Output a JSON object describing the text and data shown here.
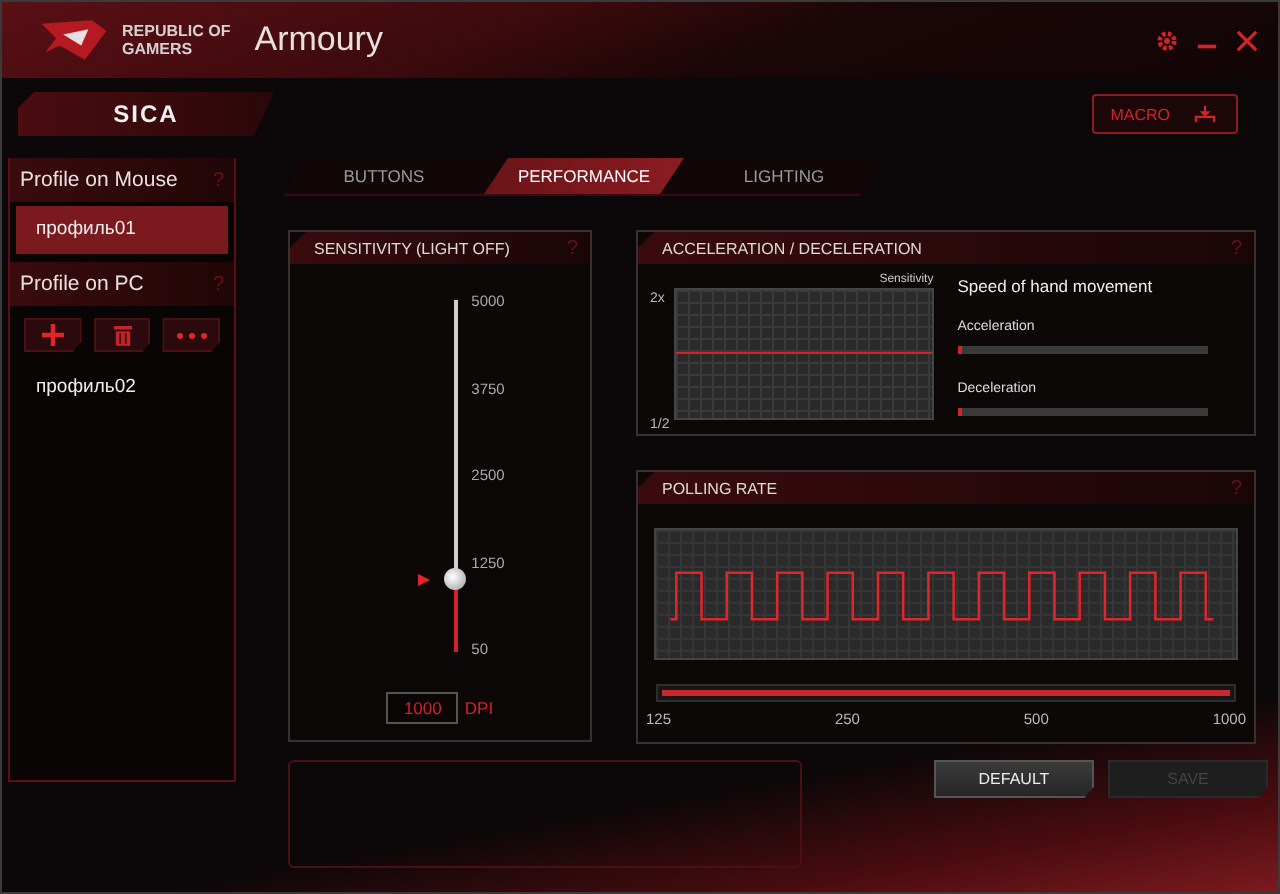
{
  "window": {
    "brand_lines": [
      "REPUBLIC OF",
      "GAMERS"
    ],
    "title": "Armoury"
  },
  "device": {
    "name": "SICA"
  },
  "macro_button": {
    "label": "MACRO"
  },
  "sidebar": {
    "sections": [
      {
        "title": "Profile on Mouse",
        "help": "?",
        "profiles": [
          {
            "name": "профиль01",
            "selected": true
          }
        ]
      },
      {
        "title": "Profile on PC",
        "help": "?",
        "toolbar": [
          {
            "kind": "add"
          },
          {
            "kind": "delete"
          },
          {
            "kind": "more"
          }
        ],
        "profiles": [
          {
            "name": "профиль02",
            "selected": false
          }
        ]
      }
    ]
  },
  "tabs": [
    {
      "label": "BUTTONS",
      "selected": false
    },
    {
      "label": "PERFORMANCE",
      "selected": true
    },
    {
      "label": "LIGHTING",
      "selected": false
    }
  ],
  "sensitivity": {
    "title": "SENSITIVITY (LIGHT OFF)",
    "help": "?",
    "ticks": [
      "5000",
      "3750",
      "2500",
      "1250",
      "50"
    ],
    "level": 0.19,
    "value": "1000",
    "unit": "DPI"
  },
  "acceleration": {
    "title": "ACCELERATION / DECELERATION",
    "help": "?",
    "graph_top": "2x",
    "graph_bottom": "1/2",
    "graph_axis": "Sensitivity",
    "heading": "Speed of hand movement",
    "sliders": [
      {
        "label": "Acceleration",
        "level": 0.02
      },
      {
        "label": "Deceleration",
        "level": 0.02
      }
    ]
  },
  "polling_rate": {
    "title": "POLLING RATE",
    "help": "?",
    "level": 1,
    "ticks": [
      "125",
      "250",
      "500",
      "1000"
    ]
  },
  "buttons": [
    {
      "label": "DEFAULT",
      "disabled": false
    },
    {
      "label": "SAVE",
      "disabled": true
    }
  ]
}
